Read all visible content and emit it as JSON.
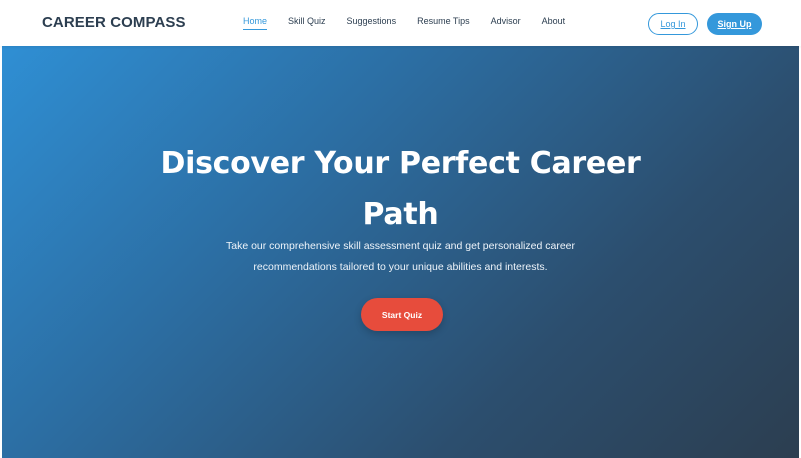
{
  "navbar": {
    "logo": "CAREER COMPASS",
    "links": [
      {
        "label": "Home",
        "active": true
      },
      {
        "label": "Skill Quiz",
        "active": false
      },
      {
        "label": "Suggestions",
        "active": false
      },
      {
        "label": "Resume Tips",
        "active": false
      },
      {
        "label": "Advisor",
        "active": false
      },
      {
        "label": "About",
        "active": false
      }
    ],
    "login_label": "Log In",
    "signup_label": "Sign Up"
  },
  "hero": {
    "title": "Discover Your Perfect Career Path",
    "subtitle": "Take our comprehensive skill assessment quiz and get personalized career recommendations tailored to your unique abilities and interests.",
    "cta_label": "Start Quiz"
  },
  "colors": {
    "accent": "#3498db",
    "dark": "#2c3e50",
    "cta": "#e74c3c"
  }
}
